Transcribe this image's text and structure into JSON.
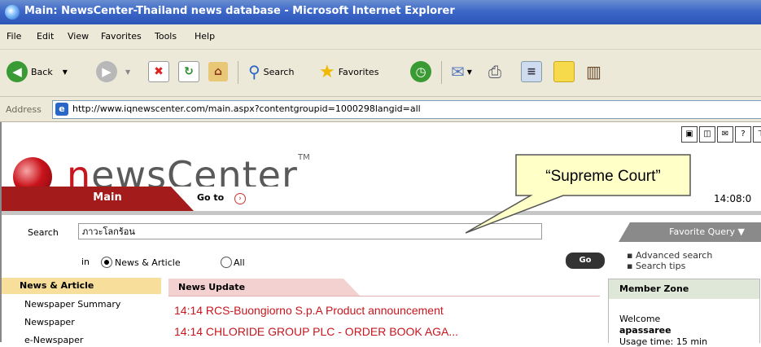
{
  "window": {
    "title": "Main: NewsCenter-Thailand news database - Microsoft Internet Explorer"
  },
  "menu": {
    "items": [
      "File",
      "Edit",
      "View",
      "Favorites",
      "Tools",
      "Help"
    ]
  },
  "toolbar": {
    "back_label": "Back",
    "search_label": "Search",
    "favorites_label": "Favorites"
  },
  "address": {
    "label": "Address",
    "url": "http://www.iqnewscenter.com/main.aspx?contentgroupid=1000298langid=all"
  },
  "logo": {
    "text_red": "n",
    "text_rest": "ewsCenter",
    "tm": "TM"
  },
  "top_icons": [
    "▣",
    "◫",
    "✉",
    "?",
    "⊤"
  ],
  "nav": {
    "main": "Main",
    "goto": "Go to",
    "time": "14:08:0"
  },
  "search": {
    "label": "Search",
    "value": "ภาวะโลกร้อน",
    "in_label": "in",
    "opt_news": "News & Article",
    "opt_all": "All",
    "go": "Go",
    "favorite_query": "Favorite Query ▼",
    "advanced": "Advanced search",
    "tips": "Search tips"
  },
  "left_panel": {
    "header": "News & Article",
    "items": [
      "Newspaper Summary",
      "Newspaper",
      "e-Newspaper"
    ]
  },
  "news": {
    "header": "News Update",
    "items": [
      "14:14 RCS-Buongiorno S.p.A Product announcement",
      "14:14 CHLORIDE GROUP PLC - ORDER BOOK AGA..."
    ]
  },
  "member": {
    "header": "Member Zone",
    "welcome": "Welcome",
    "user": "apassaree",
    "usage": "Usage time: 15 min"
  },
  "callout": {
    "text": "“Supreme Court”"
  }
}
